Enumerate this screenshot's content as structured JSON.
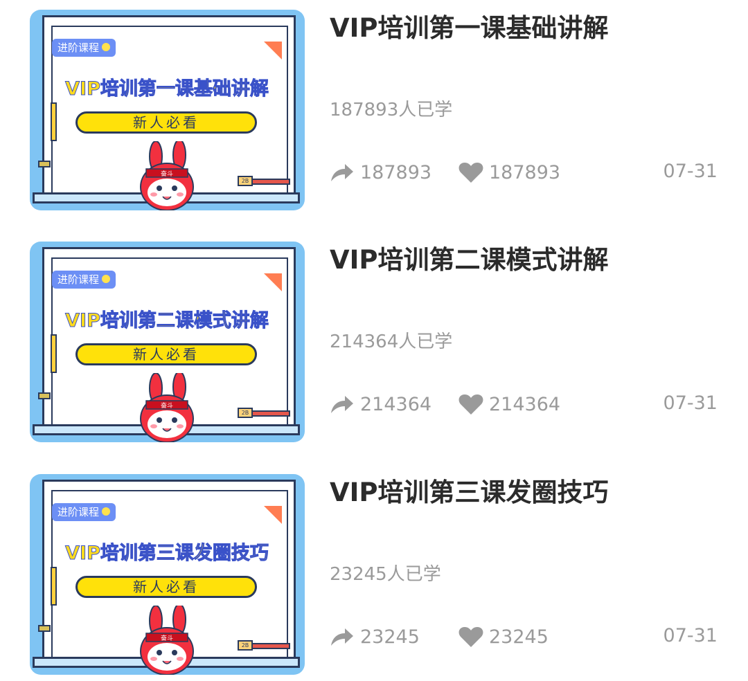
{
  "courses": [
    {
      "title": "VIP培训第一课基础讲解",
      "thumbnail": {
        "tag": "进阶课程",
        "title": "VIP培训第一课基础讲解",
        "subtitle": "新人必看",
        "mascot_badge": "奋斗",
        "pencil_label": "2B"
      },
      "learners": "187893人已学",
      "shares": "187893",
      "likes": "187893",
      "date": "07-31"
    },
    {
      "title": "VIP培训第二课模式讲解",
      "thumbnail": {
        "tag": "进阶课程",
        "title": "VIP培训第二课模式讲解",
        "subtitle": "新人必看",
        "mascot_badge": "奋斗",
        "pencil_label": "2B"
      },
      "learners": "214364人已学",
      "shares": "214364",
      "likes": "214364",
      "date": "07-31"
    },
    {
      "title": "VIP培训第三课发圈技巧",
      "thumbnail": {
        "tag": "进阶课程",
        "title": "VIP培训第三课发圈技巧",
        "subtitle": "新人必看",
        "mascot_badge": "奋斗",
        "pencil_label": "2B"
      },
      "learners": "23245人已学",
      "shares": "23245",
      "likes": "23245",
      "date": "07-31"
    }
  ],
  "icons": {
    "share": "share-icon",
    "like": "heart-icon"
  },
  "colors": {
    "title_text": "#2b2b2b",
    "meta_text": "#9a9a9a",
    "thumb_bg": "#7fc4f3",
    "thumb_title_fill": "#ffdb1f",
    "thumb_sub_fill": "#ffe10a",
    "tag_bg": "#6c8ff5",
    "mascot": "#f2303f"
  }
}
